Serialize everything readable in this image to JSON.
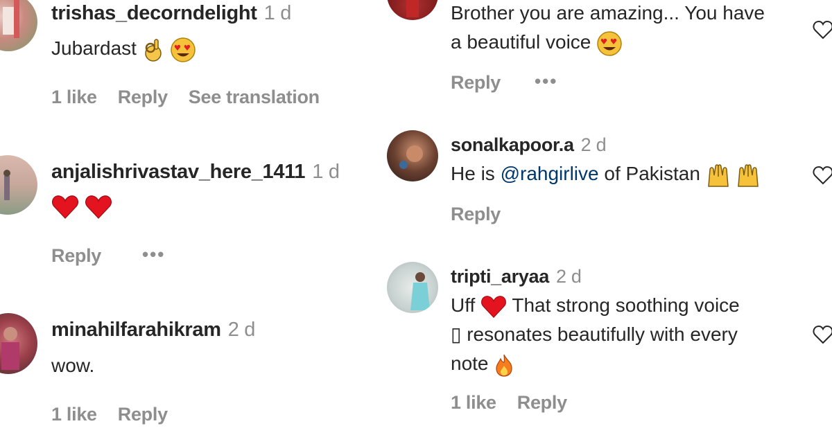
{
  "left_column": [
    {
      "username": "trishas_decorndelight",
      "time": "1 d",
      "text": "Jubardast",
      "emojis": [
        "ok-hand-icon",
        "heart-eyes-icon"
      ],
      "likes": "1 like",
      "reply": "Reply",
      "see_translation": "See translation"
    },
    {
      "username": "anjalishrivastav_here_1411",
      "time": "1 d",
      "emojis": [
        "red-heart-icon",
        "red-heart-icon"
      ],
      "reply": "Reply",
      "more": "•••"
    },
    {
      "username": "minahilfarahikram",
      "time": "2 d",
      "text": "wow.",
      "likes": "1 like",
      "reply": "Reply"
    }
  ],
  "right_column": [
    {
      "text_line1": "Brother you are amazing... You have",
      "text_line2": "a beautiful voice",
      "emojis": [
        "heart-eyes-icon"
      ],
      "reply": "Reply",
      "more": "•••"
    },
    {
      "username": "sonalkapoor.a",
      "time": "2 d",
      "text_prefix": "He is ",
      "mention": "@rahgirlive",
      "text_suffix": " of Pakistan",
      "emojis": [
        "raised-hands-icon",
        "raised-hands-icon"
      ],
      "reply": "Reply"
    },
    {
      "username": "tripti_aryaa",
      "time": "2 d",
      "text_line1_a": "Uff",
      "text_line1_b": "That strong soothing voice",
      "text_line2": "▯ resonates beautifully with every",
      "text_line3": "note",
      "emojis": [
        "red-heart-icon",
        "fire-icon"
      ],
      "likes": "1 like",
      "reply": "Reply"
    }
  ]
}
